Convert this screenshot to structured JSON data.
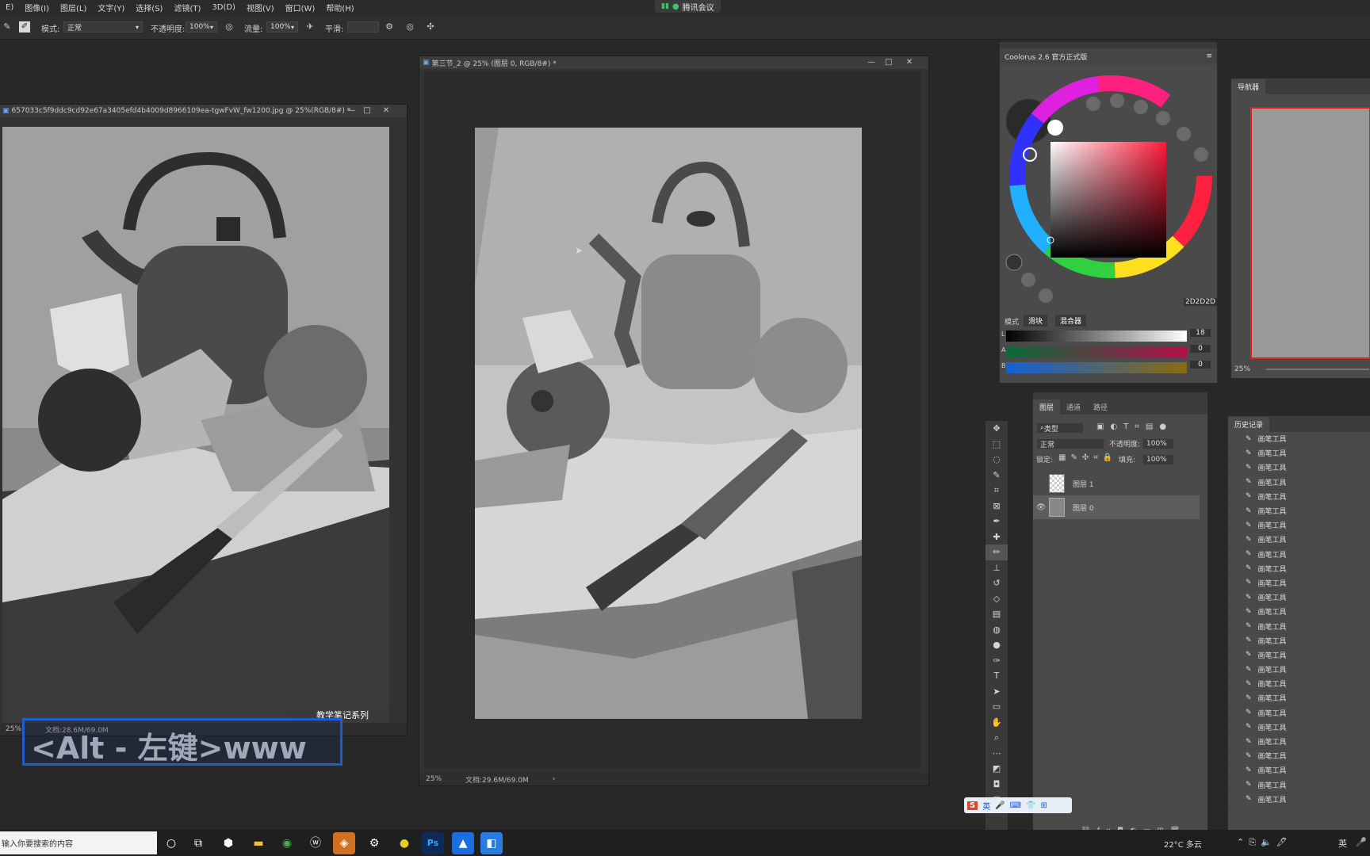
{
  "menu": [
    "图像(I)",
    "图层(L)",
    "文字(Y)",
    "选择(S)",
    "滤镜(T)",
    "3D(D)",
    "视图(V)",
    "窗口(W)",
    "帮助(H)"
  ],
  "meeting": "腾讯会议",
  "options": {
    "mode_label": "模式:",
    "mode_value": "正常",
    "opacity_label": "不透明度:",
    "opacity_value": "100%",
    "flow_label": "流量:",
    "flow_value": "100%",
    "smooth_label": "平滑:"
  },
  "ref_window": {
    "title": "657033c5f9ddc9cd92e67a3405efd4b4009d8966109ea-tgwFvW_fw1200.jpg @ 25%(RGB/8#) *",
    "zoom": "25%",
    "doc": "文档:28.6M/69.0M",
    "watermark": "教学笔记系列"
  },
  "main_window": {
    "title": "第三节_2 @ 25% (图层 0, RGB/8#) *",
    "zoom": "25%",
    "doc": "文档:29.6M/69.0M"
  },
  "overlay": "<Alt - 左键>www",
  "coolorus": {
    "title": "Coolorus 2.6 官方正式版",
    "mode_label": "模式",
    "tab_slider": "滑块",
    "tab_mixer": "混合器",
    "hex": "2D2D2D",
    "l_value": "18",
    "a_value": "0",
    "b_value": "0",
    "l": "L",
    "a": "A",
    "b": "B",
    "accent": "#ff3a55"
  },
  "navigator": {
    "tab": "导航器",
    "zoom": "25%"
  },
  "layers": {
    "tabs": [
      "图层",
      "通道",
      "路径"
    ],
    "filter_type": "类型",
    "blend": "正常",
    "opacity_label": "不透明度:",
    "opacity_value": "100%",
    "lock_label": "锁定:",
    "fill_label": "填充:",
    "fill_value": "100%",
    "rows": [
      {
        "name": "图层 1",
        "visible": false
      },
      {
        "name": "图层 0",
        "visible": true
      }
    ]
  },
  "history": {
    "tab": "历史记录",
    "item_label": "画笔工具",
    "count": 26
  },
  "ime": {
    "label": "英"
  },
  "taskbar": {
    "search_placeholder": "输入你要搜索的内容",
    "weather": "22°C 多云",
    "lang": "英"
  }
}
